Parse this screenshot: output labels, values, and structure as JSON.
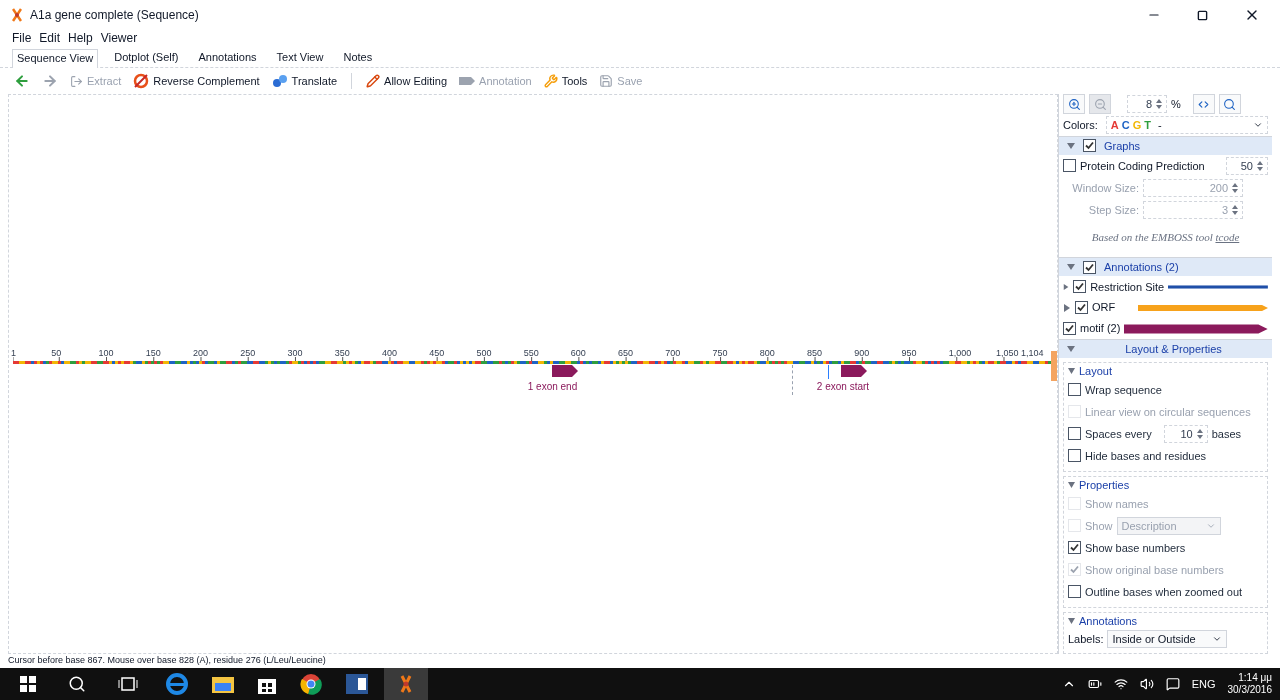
{
  "window": {
    "title": "A1a gene complete (Sequence)"
  },
  "menu": [
    "File",
    "Edit",
    "Help",
    "Viewer"
  ],
  "tabs": [
    {
      "label": "Sequence View",
      "selected": true
    },
    {
      "label": "Dotplot (Self)",
      "selected": false
    },
    {
      "label": "Annotations",
      "selected": false
    },
    {
      "label": "Text View",
      "selected": false
    },
    {
      "label": "Notes",
      "selected": false
    }
  ],
  "toolbar": [
    {
      "kind": "back",
      "disabled": false
    },
    {
      "kind": "forward",
      "disabled": true
    },
    {
      "kind": "extract",
      "label": "Extract",
      "disabled": true
    },
    {
      "kind": "revcomp",
      "label": "Reverse Complement",
      "disabled": false
    },
    {
      "kind": "translate",
      "label": "Translate",
      "disabled": false
    },
    {
      "kind": "separator"
    },
    {
      "kind": "edit",
      "label": "Allow Editing",
      "disabled": false
    },
    {
      "kind": "annotation",
      "label": "Annotation",
      "disabled": true
    },
    {
      "kind": "tools",
      "label": "Tools",
      "disabled": false
    },
    {
      "kind": "save",
      "label": "Save",
      "disabled": true
    }
  ],
  "ruler": {
    "ticks": [
      "1",
      "50",
      "100",
      "150",
      "200",
      "250",
      "300",
      "350",
      "400",
      "450",
      "500",
      "550",
      "600",
      "650",
      "700",
      "750",
      "800",
      "850",
      "900",
      "950",
      "1,000",
      "1,050",
      "1,104"
    ]
  },
  "features": [
    {
      "label": "1 exon end"
    },
    {
      "label": "2 exon start"
    }
  ],
  "panel": {
    "zoom": "8",
    "zoom_unit": "%",
    "colors": {
      "label": "Colors:",
      "letters": [
        {
          "text": "A",
          "color": "#e53935"
        },
        {
          "text": "C",
          "color": "#1e63c4"
        },
        {
          "text": "G",
          "color": "#f2b705"
        },
        {
          "text": "T",
          "color": "#2e9e3e"
        }
      ],
      "suffix": "-"
    },
    "graphs": {
      "title": "Graphs",
      "checked": true,
      "expanded": true,
      "prediction": {
        "label": "Protein Coding Prediction",
        "checked": false,
        "value": "50"
      },
      "fields": [
        {
          "label": "Window Size:",
          "value": "200"
        },
        {
          "label": "Step Size:",
          "value": "3"
        }
      ],
      "note": "Based on the EMBOSS tool",
      "note_link": "tcode"
    },
    "annotations": {
      "title": "Annotations (2)",
      "checked": true,
      "expanded": true,
      "items": [
        {
          "label": "Restriction Site",
          "checked": true,
          "kind": "line",
          "color": "#1f4fa8",
          "expandable": true
        },
        {
          "label": "ORF",
          "checked": true,
          "kind": "arrow",
          "color": "#f7a21b",
          "expandable": true
        },
        {
          "label": "motif (2)",
          "checked": true,
          "kind": "thick-arrow",
          "color": "#8b1a5c",
          "expandable": false
        }
      ]
    },
    "layout_properties": {
      "title": "Layout & Properties",
      "expanded": true,
      "layout": {
        "title": "Layout",
        "options": [
          {
            "kind": "check",
            "label": "Wrap sequence",
            "checked": false,
            "disabled": false
          },
          {
            "kind": "check",
            "label": "Linear view on circular sequences",
            "checked": false,
            "disabled": true
          },
          {
            "kind": "spin",
            "label": "Spaces every",
            "checked": false,
            "disabled": false,
            "value": "10",
            "suffix": "bases"
          },
          {
            "kind": "check",
            "label": "Hide bases and residues",
            "checked": false,
            "disabled": false
          }
        ]
      },
      "properties": {
        "title": "Properties",
        "options": [
          {
            "kind": "check",
            "label": "Show names",
            "checked": false,
            "disabled": true
          },
          {
            "kind": "select",
            "label": "Show",
            "checked": false,
            "disabled": true,
            "value": "Description"
          },
          {
            "kind": "check",
            "label": "Show base numbers",
            "checked": true,
            "disabled": false
          },
          {
            "kind": "check",
            "label": "Show original base numbers",
            "checked": true,
            "disabled": true
          },
          {
            "kind": "check",
            "label": "Outline bases when zoomed out",
            "checked": false,
            "disabled": false
          }
        ]
      },
      "annotations": {
        "title": "Annotations",
        "labels_label": "Labels:",
        "labels_value": "Inside or Outside"
      }
    }
  },
  "status_bar": "Cursor before base 867. Mouse over base 828 (A), residue 276 (L/Leu/Leucine)",
  "taskbar": {
    "language": "ENG",
    "time": "1:14 μμ",
    "date": "30/3/2016"
  }
}
